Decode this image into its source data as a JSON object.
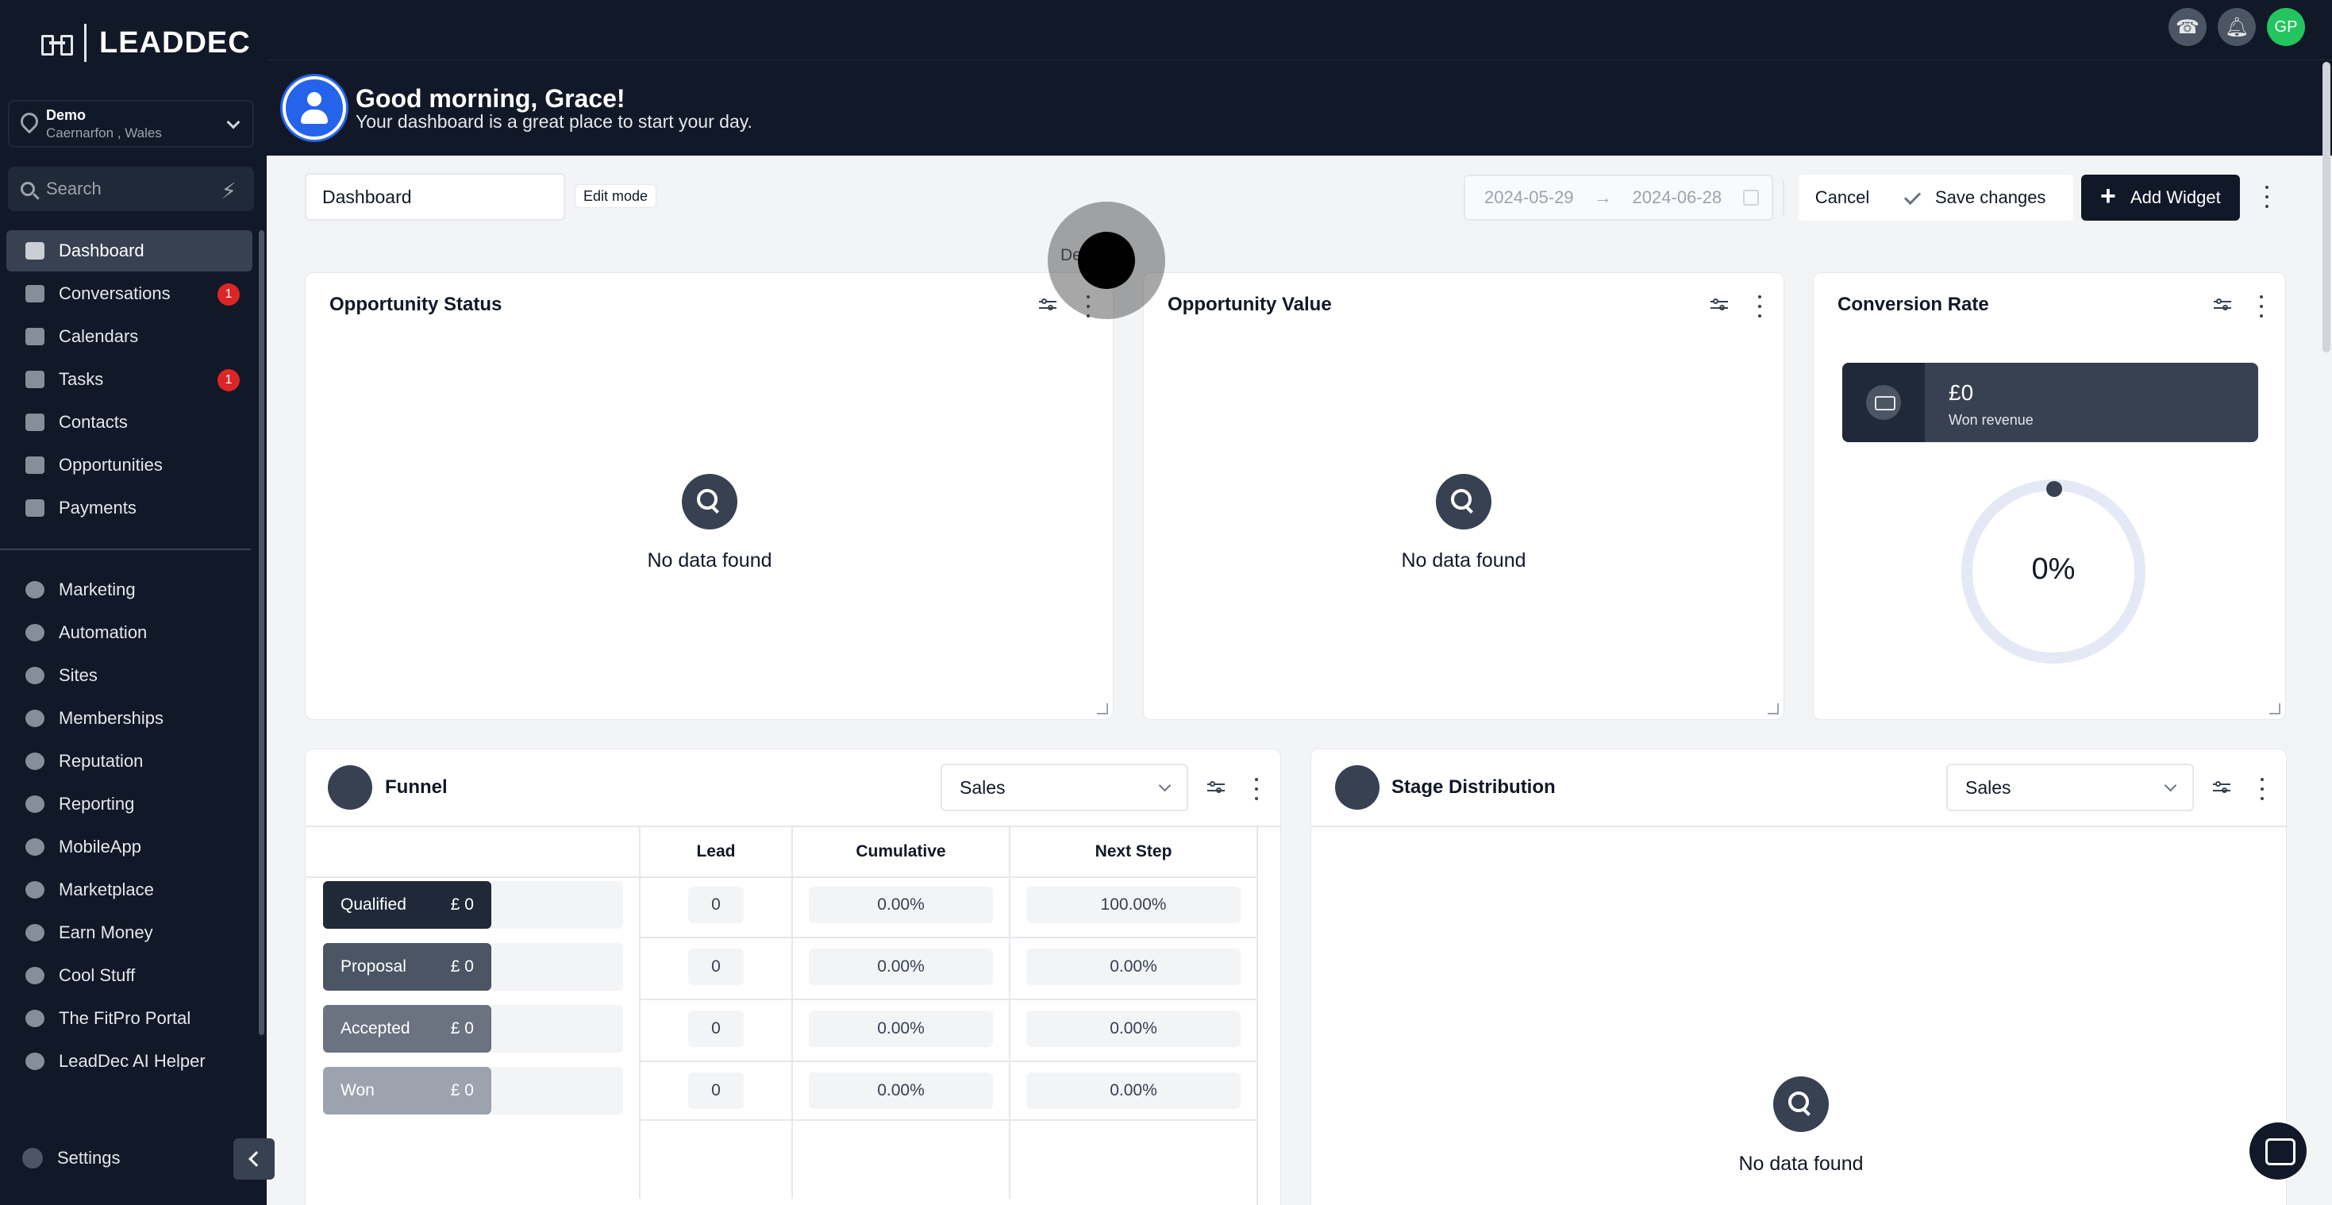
{
  "brand": {
    "name": "LEADDEC"
  },
  "location": {
    "name": "Demo",
    "sub": "Caernarfon , Wales"
  },
  "search": {
    "placeholder": "Search"
  },
  "sidebar": {
    "items": [
      {
        "label": "Dashboard",
        "icon": "dashboard-icon",
        "active": true
      },
      {
        "label": "Conversations",
        "icon": "chat-icon",
        "badge": "1"
      },
      {
        "label": "Calendars",
        "icon": "calendar-icon"
      },
      {
        "label": "Tasks",
        "icon": "checkbox-icon",
        "badge": "1"
      },
      {
        "label": "Contacts",
        "icon": "person-icon"
      },
      {
        "label": "Opportunities",
        "icon": "funnel-icon"
      },
      {
        "label": "Payments",
        "icon": "card-icon"
      },
      {
        "label": "Marketing",
        "icon": "megaphone-icon"
      },
      {
        "label": "Automation",
        "icon": "automation-icon"
      },
      {
        "label": "Sites",
        "icon": "sites-icon"
      },
      {
        "label": "Memberships",
        "icon": "group-icon"
      },
      {
        "label": "Reputation",
        "icon": "star-icon"
      },
      {
        "label": "Reporting",
        "icon": "pie-icon"
      },
      {
        "label": "MobileApp",
        "icon": "phone-icon"
      },
      {
        "label": "Marketplace",
        "icon": "cart-icon"
      },
      {
        "label": "Earn Money",
        "icon": "money-icon"
      },
      {
        "label": "Cool Stuff",
        "icon": "flame-icon"
      },
      {
        "label": "The FitPro Portal",
        "icon": "dumbbell-icon"
      },
      {
        "label": "LeadDec AI Helper",
        "icon": "robot-icon"
      }
    ],
    "settings": "Settings"
  },
  "topbar": {
    "avatar_initials": "GP"
  },
  "greeting": {
    "title": "Good morning, Grace!",
    "subtitle": "Your dashboard is a great place to start your day."
  },
  "toolbar": {
    "dashboard_name": "Dashboard",
    "edit_mode": "Edit mode",
    "date_start": "2024-05-29",
    "date_end": "2024-06-28",
    "cancel": "Cancel",
    "save": "Save changes",
    "add_widget": "Add Widget",
    "tooltip": "De"
  },
  "widgets": {
    "opportunity_status": {
      "title": "Opportunity Status",
      "empty": "No data found"
    },
    "opportunity_value": {
      "title": "Opportunity Value",
      "empty": "No data found"
    },
    "conversion_rate": {
      "title": "Conversion Rate",
      "amount": "£0",
      "amount_label": "Won revenue",
      "rate": "0%",
      "rate_value": 0
    },
    "funnel": {
      "title": "Funnel",
      "pipeline": "Sales",
      "columns": [
        "Lead",
        "Cumulative",
        "Next Step"
      ],
      "rows": [
        {
          "stage": "Qualified",
          "amount": "£ 0",
          "lead": "0",
          "cumulative": "0.00%",
          "next": "100.00%",
          "color": "#1f2937"
        },
        {
          "stage": "Proposal",
          "amount": "£ 0",
          "lead": "0",
          "cumulative": "0.00%",
          "next": "0.00%",
          "color": "#4b5563"
        },
        {
          "stage": "Accepted",
          "amount": "£ 0",
          "lead": "0",
          "cumulative": "0.00%",
          "next": "0.00%",
          "color": "#6b7280"
        },
        {
          "stage": "Won",
          "amount": "£ 0",
          "lead": "0",
          "cumulative": "0.00%",
          "next": "0.00%",
          "color": "#9ca3af"
        }
      ]
    },
    "stage_distribution": {
      "title": "Stage Distribution",
      "pipeline": "Sales",
      "empty": "No data found"
    }
  }
}
